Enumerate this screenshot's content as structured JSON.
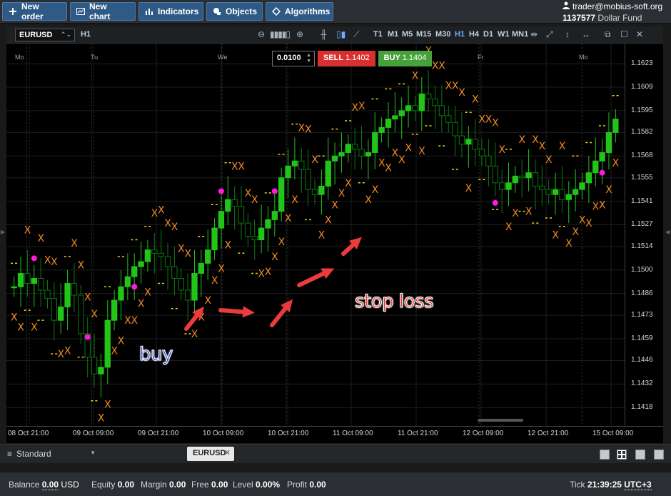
{
  "toolbar": {
    "buttons": [
      {
        "label": "New order",
        "icon": "plus-icon"
      },
      {
        "label": "New chart",
        "icon": "chart-icon"
      },
      {
        "label": "Indicators",
        "icon": "bars-icon"
      },
      {
        "label": "Objects",
        "icon": "objects-icon"
      },
      {
        "label": "Algorithms",
        "icon": "diamond-icon"
      }
    ]
  },
  "account": {
    "email": "trader@mobius-soft.org",
    "number": "1137577",
    "fund": "Dollar Fund"
  },
  "chart": {
    "symbol": "EURUSD",
    "period": "H1",
    "timeframes": [
      "T1",
      "M1",
      "M5",
      "M15",
      "M30",
      "H1",
      "H4",
      "D1",
      "W1",
      "MN1"
    ],
    "active_timeframe": "H1",
    "days": [
      "Mo",
      "Tu",
      "We",
      "Fr",
      "Mo"
    ],
    "lot": "0.0100",
    "sell_label": "SELL",
    "sell_price": "1.1402",
    "buy_label": "BUY",
    "buy_price": "1.1404",
    "annotation_buy": "buy",
    "annotation_stop": "stop loss",
    "colors": {
      "up": "#22c41a",
      "down": "#0a7a10",
      "sar_x": "#f08a24",
      "dash": "#f3d21a",
      "dot": "#ff19e0",
      "arrow": "#ec3b3b"
    }
  },
  "chart_data": {
    "type": "candlestick",
    "y_ticks": [
      1.1623,
      1.1609,
      1.1595,
      1.1582,
      1.1568,
      1.1555,
      1.1541,
      1.1527,
      1.1514,
      1.15,
      1.1486,
      1.1473,
      1.1459,
      1.1446,
      1.1432,
      1.1418
    ],
    "x_ticks": [
      "08 Oct 21:00",
      "09 Oct 09:00",
      "09 Oct 21:00",
      "10 Oct 09:00",
      "10 Oct 21:00",
      "11 Oct 09:00",
      "11 Oct 21:00",
      "12 Oct 09:00",
      "12 Oct 21:00",
      "15 Oct 09:00"
    ],
    "ylim": [
      1.1407,
      1.1635
    ],
    "close_path": [
      1.149,
      1.1498,
      1.1492,
      1.1495,
      1.1488,
      1.1483,
      1.147,
      1.1478,
      1.1492,
      1.1485,
      1.1462,
      1.1448,
      1.1438,
      1.1442,
      1.147,
      1.1482,
      1.149,
      1.1496,
      1.1502,
      1.1505,
      1.1512,
      1.151,
      1.1508,
      1.1502,
      1.1495,
      1.1488,
      1.1482,
      1.1498,
      1.1504,
      1.1512,
      1.1525,
      1.1535,
      1.1542,
      1.1538,
      1.1528,
      1.152,
      1.1518,
      1.1525,
      1.153,
      1.1535,
      1.1555,
      1.1562,
      1.1565,
      1.156,
      1.1548,
      1.1545,
      1.155,
      1.1565,
      1.1568,
      1.157,
      1.1575,
      1.1572,
      1.1568,
      1.157,
      1.1582,
      1.1585,
      1.159,
      1.1592,
      1.1595,
      1.1598,
      1.1595,
      1.1605,
      1.1602,
      1.1598,
      1.1592,
      1.1588,
      1.158,
      1.1575,
      1.1578,
      1.1572,
      1.1568,
      1.1562,
      1.1552,
      1.1548,
      1.1552,
      1.1556,
      1.1555,
      1.1558,
      1.155,
      1.1548,
      1.1545,
      1.1548,
      1.1542,
      1.1545,
      1.1548,
      1.1552,
      1.1558,
      1.1565,
      1.157,
      1.1582,
      1.159
    ]
  },
  "tabs": {
    "layout_name": "Standard",
    "symbol_tab": "EURUSD"
  },
  "status": {
    "balance_label": "Balance",
    "balance": "0.00",
    "currency": "USD",
    "equity_label": "Equity",
    "equity": "0.00",
    "margin_label": "Margin",
    "margin": "0.00",
    "free_label": "Free",
    "free": "0.00",
    "level_label": "Level",
    "level": "0.00%",
    "profit_label": "Profit",
    "profit": "0.00",
    "tick_label": "Tick",
    "tick_time": "21:39:25",
    "timezone": "UTC+3"
  }
}
